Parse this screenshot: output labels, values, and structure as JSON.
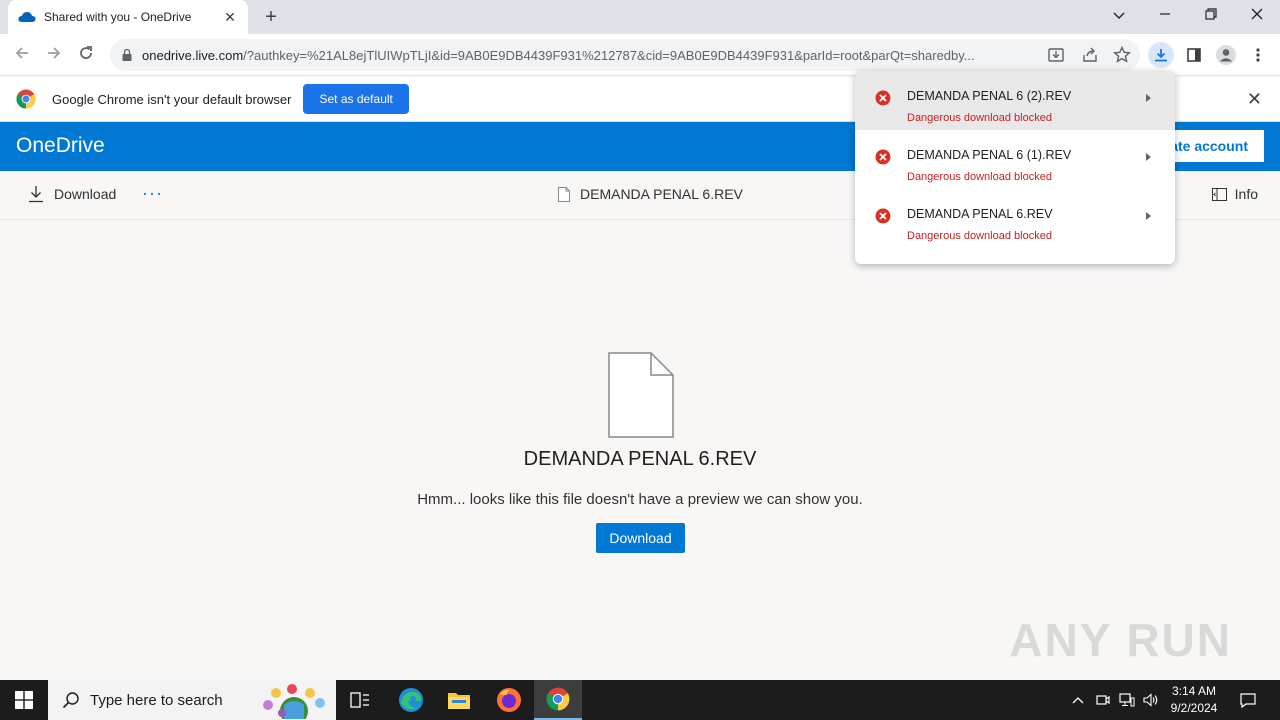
{
  "browser": {
    "tab_title": "Shared with you - OneDrive",
    "tab_close": "✕",
    "new_tab": "+",
    "url_host": "onedrive.live.com",
    "url_rest": "/?authkey=%21AL8ejTlUIWpTLjI&id=9AB0E9DB4439F931%212787&cid=9AB0E9DB4439F931&parId=root&parQt=sharedby..."
  },
  "infobar": {
    "message": "Google Chrome isn't your default browser",
    "set_default": "Set as default",
    "close": "✕"
  },
  "onedrive": {
    "brand": "OneDrive",
    "create_account": "Create account"
  },
  "commandbar": {
    "download": "Download",
    "more": "···",
    "file_name": "DEMANDA PENAL 6.REV",
    "info": "Info"
  },
  "preview": {
    "file_name": "DEMANDA PENAL 6.REV",
    "message": "Hmm... looks like this file doesn't have a preview we can show you.",
    "download_button": "Download",
    "watermark": "ANY RUN"
  },
  "downloads": {
    "items": [
      {
        "file": "DEMANDA PENAL 6 (2).REV",
        "status": "Dangerous download blocked"
      },
      {
        "file": "DEMANDA PENAL 6 (1).REV",
        "status": "Dangerous download blocked"
      },
      {
        "file": "DEMANDA PENAL 6.REV",
        "status": "Dangerous download blocked"
      }
    ]
  },
  "taskbar": {
    "search_placeholder": "Type here to search",
    "time": "3:14 AM",
    "date": "9/2/2024"
  },
  "colors": {
    "onedrive_blue": "#0078d4",
    "chrome_blue": "#1a73e8",
    "error_red": "#c5221f"
  }
}
